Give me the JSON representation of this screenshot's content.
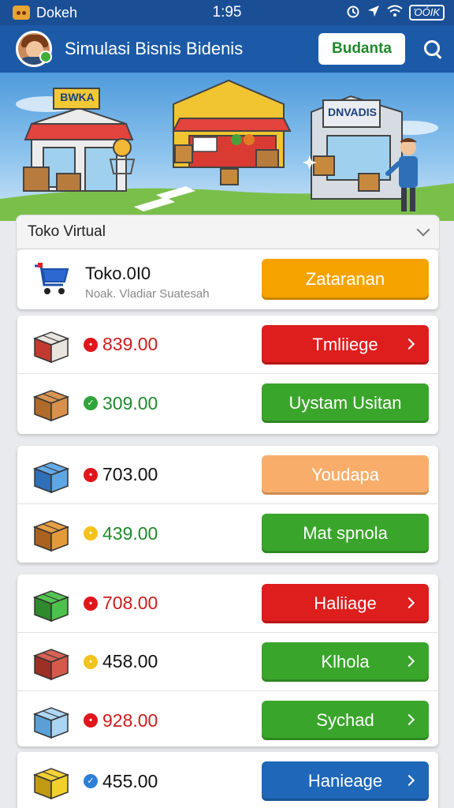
{
  "status_bar": {
    "app_name": "Dokeh",
    "time": "1:95",
    "battery": "ΌÓΙΚ"
  },
  "header": {
    "title": "Simulasi Bisnis Bidenis",
    "button_label": "Budanta"
  },
  "banner": {
    "sign_left": "BWKA",
    "sign_right": "DNVADIS"
  },
  "panel": {
    "title": "Toko Virtual"
  },
  "shop": {
    "name": "Toko.0I0",
    "subtitle": "Noak. Vladiar Suatesah",
    "button_label": "Zataranan",
    "button_color": "#f6a300"
  },
  "items": [
    {
      "icon": "goods-box-icon",
      "price": "839.00",
      "price_color": "#cc1c1c",
      "dot": "red",
      "button_label": "Tmliiege",
      "button_color": "#de1d1d",
      "arrow": true
    },
    {
      "icon": "cardboard-box-icon",
      "price": "309.00",
      "price_color": "#1f8a2c",
      "dot": "green",
      "button_label": "Uystam Usitan",
      "button_color": "#3aa52b",
      "arrow": false
    },
    {
      "icon": "blue-box-icon",
      "price": "703.00",
      "price_color": "#111111",
      "dot": "red",
      "button_label": "Youdapa",
      "button_color": "#f8ae6a",
      "arrow": false
    },
    {
      "icon": "orange-box-icon",
      "price": "439.00",
      "price_color": "#1f8a2c",
      "dot": "yellow",
      "button_label": "Mat spnola",
      "button_color": "#3aa52b",
      "arrow": false
    },
    {
      "icon": "green-box-icon",
      "price": "708.00",
      "price_color": "#cc1c1c",
      "dot": "red",
      "button_label": "Haliiage",
      "button_color": "#de1d1d",
      "arrow": true
    },
    {
      "icon": "red-box-icon",
      "price": "458.00",
      "price_color": "#111111",
      "dot": "yellow",
      "button_label": "Klhola",
      "button_color": "#3aa52b",
      "arrow": true
    },
    {
      "icon": "light-blue-box-icon",
      "price": "928.00",
      "price_color": "#cc1c1c",
      "dot": "red",
      "button_label": "Sychad",
      "button_color": "#3aa52b",
      "arrow": true
    },
    {
      "icon": "yellow-boxes-icon",
      "price": "455.00",
      "price_color": "#111111",
      "dot": "blue",
      "button_label": "Hanieage",
      "button_color": "#1f67b8",
      "arrow": true
    }
  ]
}
